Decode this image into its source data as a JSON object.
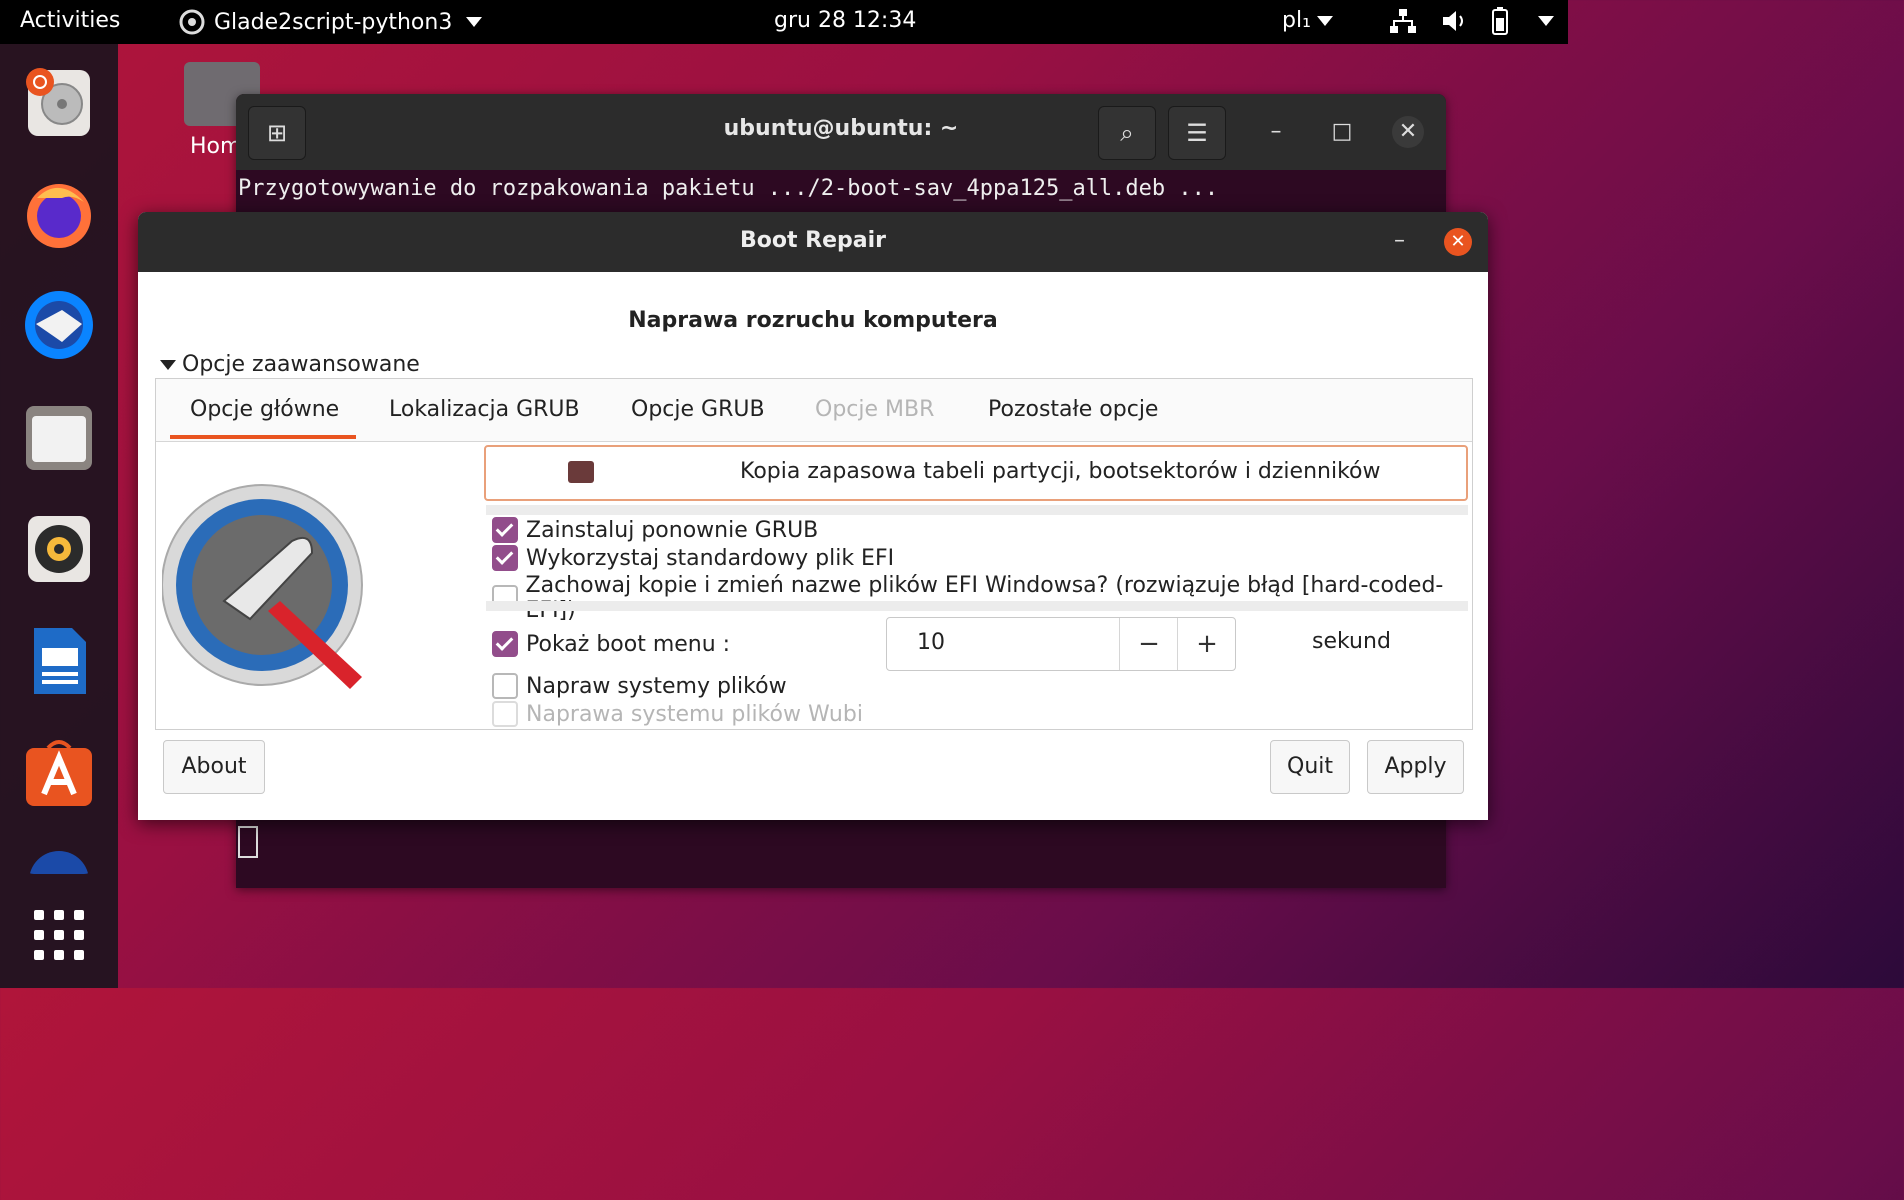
{
  "topbar": {
    "activities": "Activities",
    "app_name": "Glade2script-python3",
    "clock": "gru 28  12:34",
    "lang": "pl₁"
  },
  "desktop": {
    "home_label": "Hom"
  },
  "terminal": {
    "title": "ubuntu@ubuntu: ~",
    "line1": "Przygotowywanie do rozpakowania pakietu .../2-boot-sav_4ppa125_all.deb ..."
  },
  "dialog": {
    "title": "Boot Repair",
    "heading": "Naprawa rozruchu komputera",
    "expander": "Opcje zaawansowane",
    "tabs": [
      "Opcje główne",
      "Lokalizacja GRUB",
      "Opcje GRUB",
      "Opcje MBR",
      "Pozostałe opcje"
    ],
    "backup_label": "Kopia zapasowa tabeli partycji, bootsektorów i dzienników",
    "options": {
      "reinstall_grub": "Zainstaluj ponownie GRUB",
      "std_efi": "Wykorzystaj standardowy plik EFI",
      "keep_copies": "Zachowaj kopie i zmień nazwe plików EFI Windowsa? (rozwiązuje błąd [hard-coded-EFI])",
      "show_boot_menu": "Pokaż boot menu :",
      "repair_fs": "Napraw systemy plików",
      "repair_wubi": "Naprawa systemu plików Wubi"
    },
    "boot_menu_seconds": "10",
    "seconds_unit": "sekund",
    "about_label": "About",
    "quit_label": "Quit",
    "apply_label": "Apply"
  },
  "colors": {
    "accent": "#e95420",
    "checkbox": "#924d8b"
  }
}
